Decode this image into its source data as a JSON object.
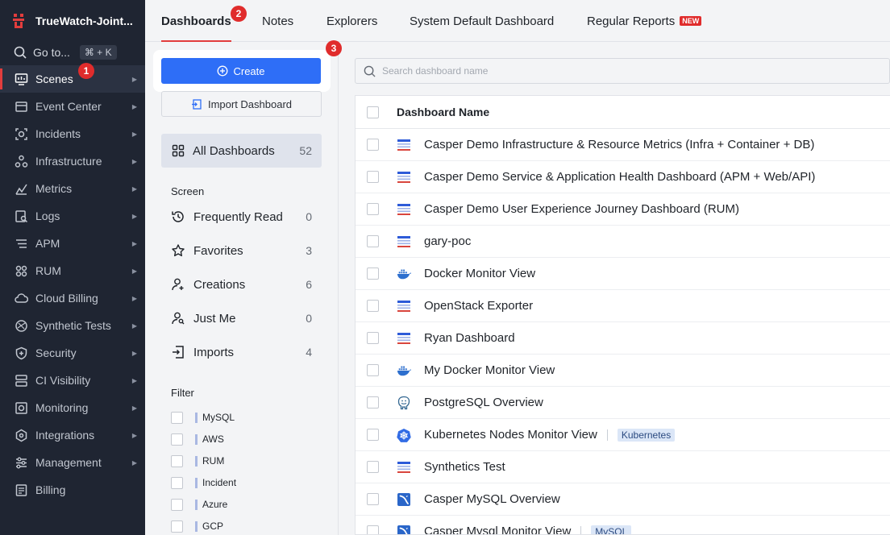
{
  "brand": {
    "title": "TrueWatch-Joint..."
  },
  "goto": {
    "label": "Go to...",
    "shortcut": "⌘ + K"
  },
  "sidebar": {
    "items": [
      {
        "label": "Scenes",
        "icon": "scenes-icon"
      },
      {
        "label": "Event Center",
        "icon": "event-icon"
      },
      {
        "label": "Incidents",
        "icon": "incidents-icon"
      },
      {
        "label": "Infrastructure",
        "icon": "infrastructure-icon"
      },
      {
        "label": "Metrics",
        "icon": "metrics-icon"
      },
      {
        "label": "Logs",
        "icon": "logs-icon"
      },
      {
        "label": "APM",
        "icon": "apm-icon"
      },
      {
        "label": "RUM",
        "icon": "rum-icon"
      },
      {
        "label": "Cloud Billing",
        "icon": "cloud-billing-icon"
      },
      {
        "label": "Synthetic Tests",
        "icon": "synthetic-icon"
      },
      {
        "label": "Security",
        "icon": "security-icon"
      },
      {
        "label": "CI Visibility",
        "icon": "ci-icon"
      },
      {
        "label": "Monitoring",
        "icon": "monitoring-icon"
      },
      {
        "label": "Integrations",
        "icon": "integrations-icon"
      },
      {
        "label": "Management",
        "icon": "management-icon"
      },
      {
        "label": "Billing",
        "icon": "billing-icon"
      }
    ]
  },
  "tabs": [
    {
      "label": "Dashboards"
    },
    {
      "label": "Notes"
    },
    {
      "label": "Explorers"
    },
    {
      "label": "System Default Dashboard"
    },
    {
      "label": "Regular Reports",
      "badge": "NEW"
    }
  ],
  "markers": [
    "1",
    "2",
    "3"
  ],
  "panel": {
    "create_label": "Create",
    "import_label": "Import Dashboard",
    "all_label": "All Dashboards",
    "all_count": "52",
    "screen_label": "Screen",
    "screen_items": [
      {
        "label": "Frequently Read",
        "count": "0"
      },
      {
        "label": "Favorites",
        "count": "3"
      },
      {
        "label": "Creations",
        "count": "6"
      },
      {
        "label": "Just Me",
        "count": "0"
      },
      {
        "label": "Imports",
        "count": "4"
      }
    ],
    "filter_label": "Filter",
    "filters": [
      "MySQL",
      "AWS",
      "RUM",
      "Incident",
      "Azure",
      "GCP"
    ]
  },
  "search": {
    "placeholder": "Search dashboard name"
  },
  "table": {
    "header": "Dashboard Name",
    "rows": [
      {
        "name": "Casper Demo Infrastructure & Resource Metrics (Infra + Container + DB)",
        "icon": "dashboard-icon"
      },
      {
        "name": "Casper Demo Service & Application Health Dashboard (APM + Web/API)",
        "icon": "dashboard-icon"
      },
      {
        "name": "Casper Demo User Experience Journey Dashboard (RUM)",
        "icon": "dashboard-icon"
      },
      {
        "name": "gary-poc",
        "icon": "dashboard-icon"
      },
      {
        "name": "Docker Monitor View",
        "icon": "docker-icon"
      },
      {
        "name": "OpenStack Exporter",
        "icon": "dashboard-icon"
      },
      {
        "name": "Ryan Dashboard",
        "icon": "dashboard-icon"
      },
      {
        "name": "My Docker Monitor View",
        "icon": "docker-icon"
      },
      {
        "name": "PostgreSQL Overview",
        "icon": "postgresql-icon"
      },
      {
        "name": "Kubernetes Nodes Monitor View",
        "icon": "kubernetes-icon",
        "tag": "Kubernetes"
      },
      {
        "name": "Synthetics Test",
        "icon": "dashboard-icon"
      },
      {
        "name": "Casper MySQL Overview",
        "icon": "mysql-icon"
      },
      {
        "name": "Casper Mysql Monitor View",
        "icon": "mysql-icon",
        "tag": "MySQL"
      }
    ]
  }
}
